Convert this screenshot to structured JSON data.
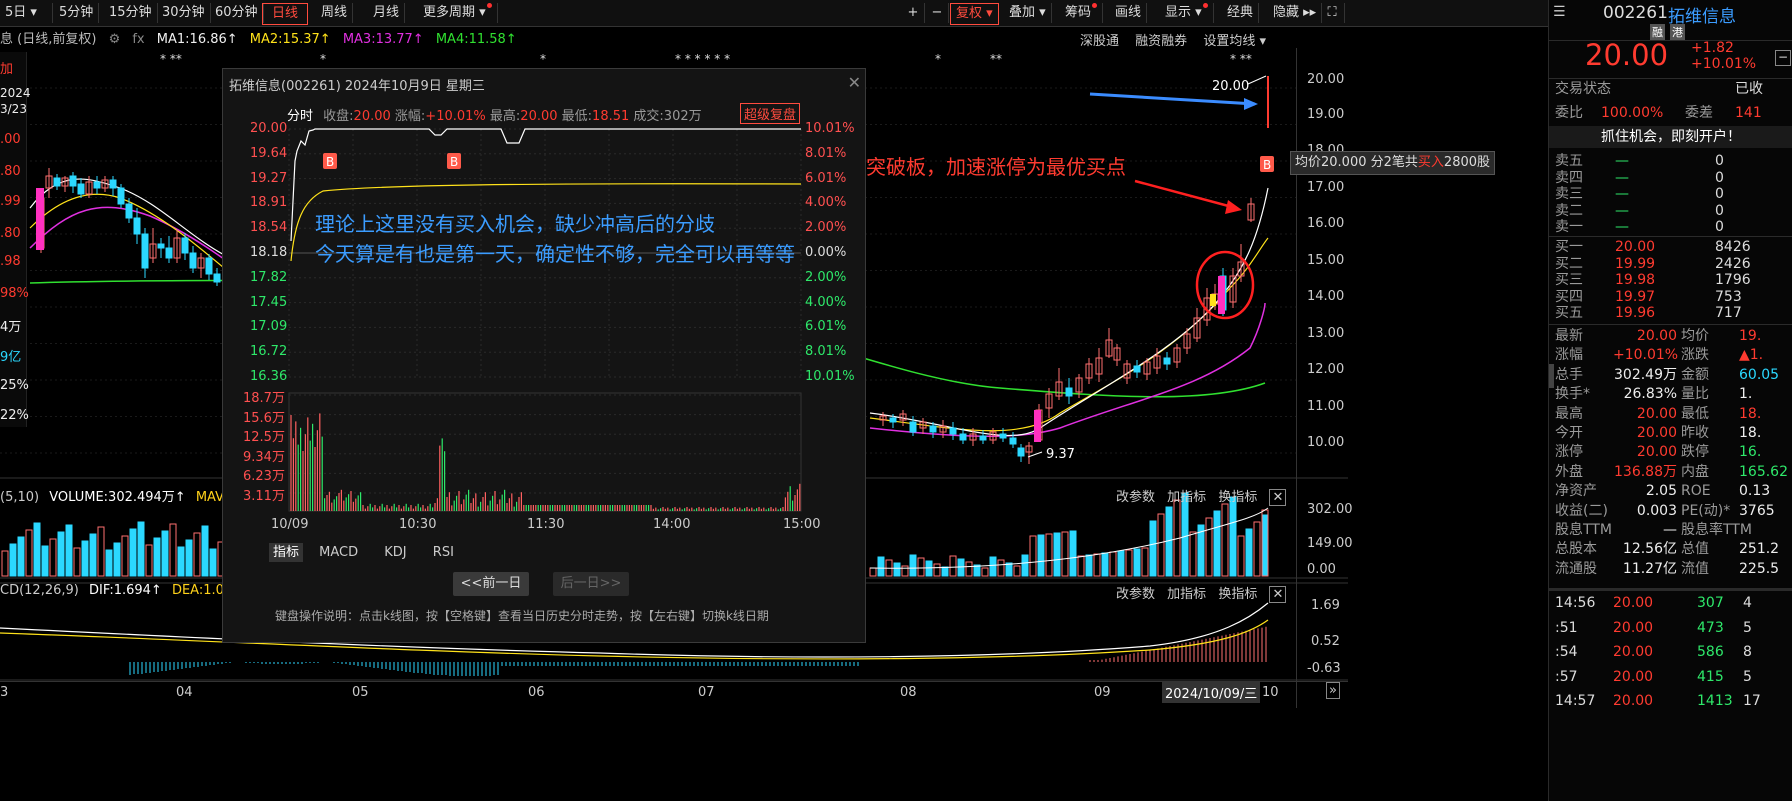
{
  "toolbar": {
    "period_5day": "5日",
    "m5": "5分钟",
    "m15": "15分钟",
    "m30": "30分钟",
    "m60": "60分钟",
    "daily": "日线",
    "weekly": "周线",
    "monthly": "月线",
    "more": "更多周期",
    "plus": "+",
    "minus": "−",
    "fuquan": "复权",
    "overlay": "叠加",
    "chips": "筹码",
    "draw": "画线",
    "display": "显示",
    "classic": "经典",
    "hide": "隐藏"
  },
  "ma_bar": {
    "prefix": "息 (日线,前复权)",
    "ma1": "MA1:16.86↑",
    "ma2": "MA2:15.37↑",
    "ma3": "MA3:13.77↑",
    "ma4": "MA4:11.58↑",
    "link1": "深股通",
    "link2": "融资融券",
    "link3": "设置均线"
  },
  "left_info": [
    "加",
    "2024",
    "3/23",
    ".00",
    ".80",
    ".99",
    ".80",
    ".98",
    "98%",
    "4万",
    "9亿",
    "25%",
    "22%"
  ],
  "price_axis": [
    "20.00",
    "19.00",
    "18.00",
    "17.00",
    "16.00",
    "15.00",
    "14.00",
    "13.00",
    "12.00",
    "11.00",
    "10.00"
  ],
  "vol_axis": [
    "302.00",
    "149.00",
    "0.00"
  ],
  "macd_axis": [
    "1.69",
    "0.52",
    "-0.63"
  ],
  "date_axis": [
    "3",
    "04",
    "05",
    "06",
    "07",
    "08",
    "09",
    "10"
  ],
  "date_box": "2024/10/09/三",
  "vol_bar": {
    "label": "(5,10)",
    "volume": "VOLUME:302.494万↑",
    "mavol": "MAVO"
  },
  "macd_bar": {
    "label": "CD(12,26,9)",
    "dif": "DIF:1.694↑",
    "dea": "DEA:1.077"
  },
  "sub_links": [
    "改参数",
    "加指标",
    "换指标"
  ],
  "chart_notes": {
    "top_price": "20.00",
    "low_price": "9.37",
    "avg_tip": {
      "prefix": "均价20.000  分2笔共",
      "buy": "买入",
      "suffix": "2800股"
    }
  },
  "annotations": {
    "breakout": "突破板，加速涨停为最优买点",
    "line1": "理论上这里没有买入机会，缺少冲高后的分歧",
    "line2": "今天算是有也是第一天，确定性不够，完全可以再等等"
  },
  "modal": {
    "title": "拓维信息(002261) 2024年10月9日 星期三",
    "fenshi": "分时",
    "close_label": "收盘:",
    "close_val": "20.00",
    "chg_label": "涨幅:",
    "chg_val": "+10.01%",
    "high_label": "最高:",
    "high_val": "20.00",
    "low_label": "最低:",
    "low_val": "18.51",
    "vol_label": "成交:",
    "vol_val": "302万",
    "super_replay": "超级复盘",
    "price_labels": [
      "20.00",
      "19.64",
      "19.27",
      "18.91",
      "18.54",
      "18.18",
      "17.82",
      "17.45",
      "17.09",
      "16.72",
      "16.36"
    ],
    "pct_labels": [
      "10.01%",
      "8.01%",
      "6.01%",
      "4.00%",
      "2.00%",
      "0.00%",
      "2.00%",
      "4.00%",
      "6.01%",
      "8.01%",
      "10.01%"
    ],
    "vol_labels": [
      "18.7万",
      "15.6万",
      "12.5万",
      "9.34万",
      "6.23万",
      "3.11万"
    ],
    "time_labels": [
      "10/09",
      "10:30",
      "11:30",
      "14:00",
      "15:00"
    ],
    "tabs": [
      "指标",
      "MACD",
      "KDJ",
      "RSI"
    ],
    "prev_day": "<<前一日",
    "next_day": "后一日>>",
    "help": "键盘操作说明：点击k线图，按【空格键】查看当日历史分时走势，按【左右键】切换k线日期",
    "marker": "B"
  },
  "stock": {
    "code": "002261",
    "name": "拓维信息",
    "tag1": "融",
    "tag2": "港",
    "price": "20.00",
    "change": "+1.82",
    "change_pct": "+10.01%",
    "status_label": "交易状态",
    "status_val": "已收",
    "webi_label": "委比",
    "webi_val": "100.00%",
    "weicha_label": "委差",
    "weicha_val": "141",
    "banner": "抓住机会，即刻开户！"
  },
  "order_book": {
    "sell": [
      {
        "label": "卖五",
        "price": "—",
        "vol": "0"
      },
      {
        "label": "卖四",
        "price": "—",
        "vol": "0"
      },
      {
        "label": "卖三",
        "price": "—",
        "vol": "0"
      },
      {
        "label": "卖二",
        "price": "—",
        "vol": "0"
      },
      {
        "label": "卖一",
        "price": "—",
        "vol": "0"
      }
    ],
    "buy": [
      {
        "label": "买一",
        "price": "20.00",
        "vol": "8426"
      },
      {
        "label": "买二",
        "price": "19.99",
        "vol": "2426"
      },
      {
        "label": "买三",
        "price": "19.98",
        "vol": "1796"
      },
      {
        "label": "买四",
        "price": "19.97",
        "vol": "753"
      },
      {
        "label": "买五",
        "price": "19.96",
        "vol": "717"
      }
    ]
  },
  "stats": [
    {
      "l1": "最新",
      "v1": "20.00",
      "c1": "red",
      "l2": "均价",
      "v2": "19.",
      "c2": "red"
    },
    {
      "l1": "涨幅",
      "v1": "+10.01%",
      "c1": "red",
      "l2": "涨跌",
      "v2": "▲1.",
      "c2": "red"
    },
    {
      "l1": "总手",
      "v1": "302.49万",
      "c1": "white",
      "l2": "金额",
      "v2": "60.05",
      "c2": "cyan"
    },
    {
      "l1": "换手*",
      "v1": "26.83%",
      "c1": "white",
      "l2": "量比",
      "v2": "1.",
      "c2": "white"
    },
    {
      "l1": "最高",
      "v1": "20.00",
      "c1": "red",
      "l2": "最低",
      "v2": "18.",
      "c2": "red"
    },
    {
      "l1": "今开",
      "v1": "20.00",
      "c1": "red",
      "l2": "昨收",
      "v2": "18.",
      "c2": "white"
    },
    {
      "l1": "涨停",
      "v1": "20.00",
      "c1": "red",
      "l2": "跌停",
      "v2": "16.",
      "c2": "green"
    },
    {
      "l1": "外盘",
      "v1": "136.88万",
      "c1": "red",
      "l2": "内盘",
      "v2": "165.62",
      "c2": "green"
    },
    {
      "l1": "净资产",
      "v1": "2.05",
      "c1": "white",
      "l2": "ROE",
      "v2": "0.13",
      "c2": "white"
    },
    {
      "l1": "收益(二)",
      "v1": "0.003",
      "c1": "white",
      "l2": "PE(动)*",
      "v2": "3765",
      "c2": "white"
    },
    {
      "l1": "股息TTM",
      "v1": "—",
      "c1": "white",
      "l2": "股息率TTM",
      "v2": "",
      "c2": "white"
    },
    {
      "l1": "总股本",
      "v1": "12.56亿",
      "c1": "white",
      "l2": "总值",
      "v2": "251.2",
      "c2": "white"
    },
    {
      "l1": "流通股",
      "v1": "11.27亿",
      "c1": "white",
      "l2": "流值",
      "v2": "225.5",
      "c2": "white"
    }
  ],
  "ticks": [
    {
      "time": "14:56",
      "price": "20.00",
      "vol": "307",
      "n": "4"
    },
    {
      "time": ":51",
      "price": "20.00",
      "vol": "473",
      "n": "5"
    },
    {
      "time": ":54",
      "price": "20.00",
      "vol": "586",
      "n": "8"
    },
    {
      "time": ":57",
      "price": "20.00",
      "vol": "415",
      "n": "5"
    },
    {
      "time": "14:57",
      "price": "20.00",
      "vol": "1413",
      "n": "17"
    }
  ]
}
